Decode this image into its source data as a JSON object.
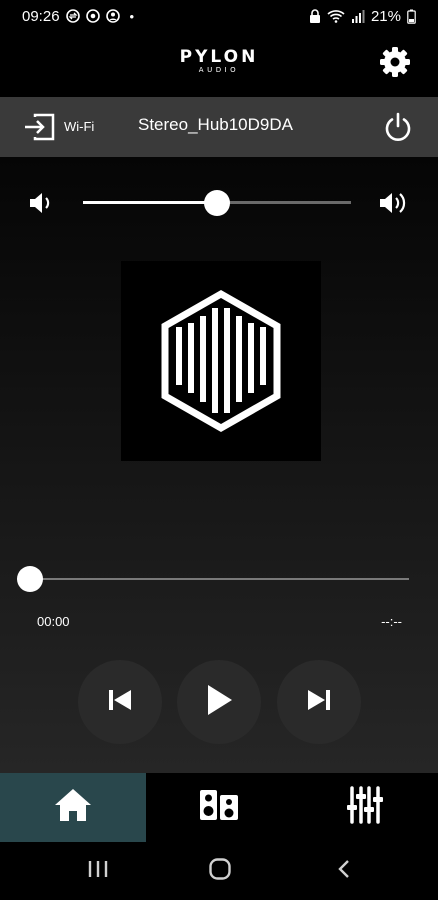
{
  "status_bar": {
    "time": "09:26",
    "dot": "•",
    "battery": "21%",
    "left_icons": [
      "swap-circle-icon",
      "settings-circle-icon",
      "account-circle-icon"
    ],
    "right_icons": [
      "lock-icon",
      "wifi-icon",
      "signal-icon",
      "battery-icon"
    ]
  },
  "header": {
    "brand": "PYLON",
    "brand_sub": "AUDIO",
    "settings_icon": "gear-icon"
  },
  "device_bar": {
    "source_icon": "input-source-icon",
    "source_label": "Wi-Fi",
    "device_name": "Stereo_Hub10D9DA",
    "power_icon": "power-icon"
  },
  "volume": {
    "level": 0.5,
    "min_icon": "volume-low-icon",
    "max_icon": "volume-high-icon"
  },
  "playback": {
    "album_art_icon": "pylon-hexagon-logo",
    "position": 0,
    "time_current": "00:00",
    "time_total": "--:--"
  },
  "controls": {
    "prev_icon": "skip-previous-icon",
    "play_icon": "play-icon",
    "next_icon": "skip-next-icon"
  },
  "bottom_nav": {
    "active": "home",
    "tabs": [
      "home-icon",
      "speakers-icon",
      "equalizer-icon"
    ]
  },
  "android_nav": [
    "recent-apps-icon",
    "home-circle-icon",
    "back-icon"
  ],
  "colors": {
    "accent_tab": "#29474c",
    "device_bar": "#3a3a3a"
  }
}
